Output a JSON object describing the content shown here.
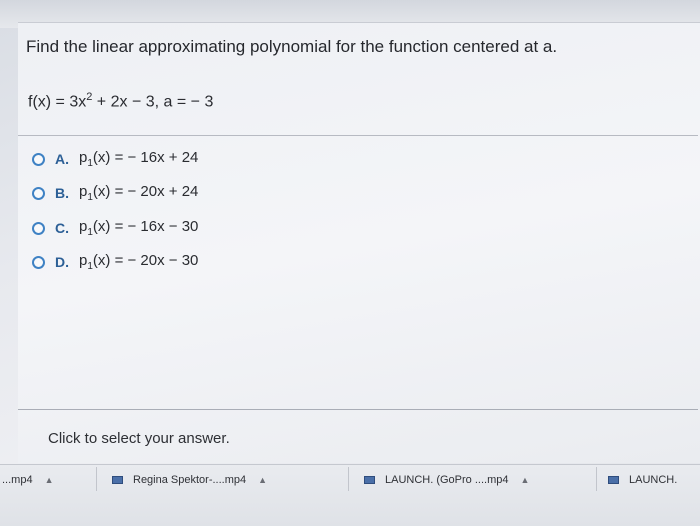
{
  "question": {
    "prompt": "Find the linear approximating polynomial for the function centered at a.",
    "function_prefix": "f(x) = 3x",
    "function_exponent": "2",
    "function_suffix": " + 2x − 3, a = − 3"
  },
  "options": [
    {
      "letter": "A.",
      "lhs": "p",
      "sub": "1",
      "rhs": "(x) = − 16x + 24"
    },
    {
      "letter": "B.",
      "lhs": "p",
      "sub": "1",
      "rhs": "(x) = − 20x + 24"
    },
    {
      "letter": "C.",
      "lhs": "p",
      "sub": "1",
      "rhs": "(x) = − 16x − 30"
    },
    {
      "letter": "D.",
      "lhs": "p",
      "sub": "1",
      "rhs": "(x) = − 20x − 30"
    }
  ],
  "instruction": "Click to select your answer.",
  "downloads": [
    {
      "label": "...mp4"
    },
    {
      "label": "Regina Spektor-....mp4"
    },
    {
      "label": "LAUNCH. (GoPro ....mp4"
    },
    {
      "label": "LAUNCH."
    }
  ],
  "icons": {
    "radio": "radio-button-icon",
    "download": "video-file-icon",
    "chevron": "chevron-up-icon"
  },
  "colors": {
    "radio_border": "#3f82c4",
    "option_letter": "#2c5f96"
  }
}
